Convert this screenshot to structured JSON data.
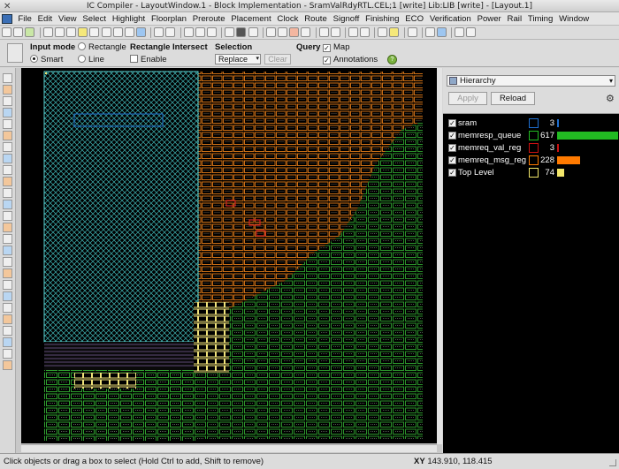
{
  "window": {
    "title": "IC Compiler - LayoutWindow.1 - Block Implementation - SramValRdyRTL.CEL;1 [write]    Lib:LIB [write] - [Layout.1]"
  },
  "menu": [
    "File",
    "Edit",
    "View",
    "Select",
    "Highlight",
    "Floorplan",
    "Preroute",
    "Placement",
    "Clock",
    "Route",
    "Signoff",
    "Finishing",
    "ECO",
    "Verification",
    "Power",
    "Rail",
    "Timing",
    "Window"
  ],
  "options": {
    "input_mode_label": "Input mode",
    "rectangle_label": "Rectangle",
    "smart_label": "Smart",
    "line_label": "Line",
    "rect_intersect_label": "Rectangle Intersect",
    "enable_label": "Enable",
    "selection_label": "Selection",
    "selection_value": "Replace",
    "clear_label": "Clear",
    "query_label": "Query",
    "map_label": "Map",
    "annotations_label": "Annotations"
  },
  "panel": {
    "dropdown": "Hierarchy",
    "apply_label": "Apply",
    "reload_label": "Reload",
    "rows": [
      {
        "name": "sram",
        "count": "3",
        "color": "#1e6fd0",
        "bar_fraction": 0.0049
      },
      {
        "name": "memresp_queue",
        "count": "617",
        "color": "#22bb22",
        "bar_fraction": 1.0
      },
      {
        "name": "memreq_val_reg",
        "count": "3",
        "color": "#cc1111",
        "bar_fraction": 0.0049
      },
      {
        "name": "memreq_msg_reg",
        "count": "228",
        "color": "#ff7a00",
        "bar_fraction": 0.37
      },
      {
        "name": "Top Level",
        "count": "74",
        "color": "#f2e66a",
        "bar_fraction": 0.12
      }
    ]
  },
  "status": {
    "message": "Click objects or drag a box to select (Hold Ctrl to add, Shift to remove)",
    "xy_label": "XY",
    "xy_value": "143.910, 118.415"
  }
}
